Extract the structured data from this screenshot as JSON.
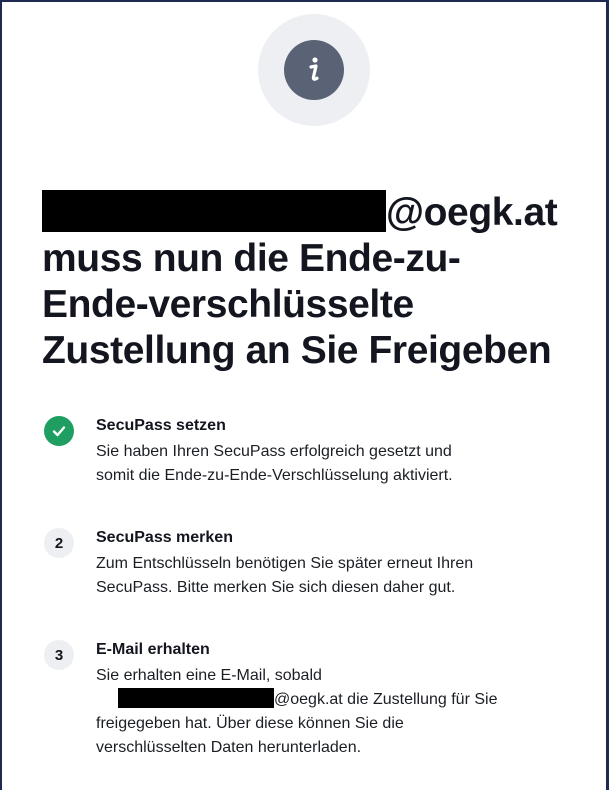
{
  "icon": {
    "name": "info-icon",
    "glyph": "i"
  },
  "heading": {
    "redacted": "[redacted]",
    "domain_suffix": "@oegk.at",
    "line2": "muss nun die Ende-zu-",
    "line3": "Ende-verschlüsselte",
    "line4": "Zustellung an Sie Freigeben"
  },
  "steps": [
    {
      "marker": "check-icon",
      "status": "done",
      "title": "SecuPass setzen",
      "text_line1": "Sie haben Ihren SecuPass erfolgreich gesetzt und",
      "text_line2": "somit die Ende-zu-Ende-Verschlüsselung aktiviert."
    },
    {
      "marker": "2",
      "title": "SecuPass merken",
      "text_line1": "Zum Entschlüsseln benötigen Sie später erneut Ihren",
      "text_line2": "SecuPass. Bitte merken Sie sich diesen daher gut."
    },
    {
      "marker": "3",
      "title": "E-Mail erhalten",
      "text_line1": "Sie erhalten eine E-Mail, sobald",
      "text_line2_suffix": "@oegk.at die Zustellung für Sie",
      "text_line3": "freigegeben hat. Über diese können Sie die",
      "text_line4": "verschlüsselten Daten herunterladen."
    }
  ],
  "colors": {
    "frame": "#1f2a52",
    "icon_bg": "#5a6275",
    "icon_halo": "#eeeff2",
    "success": "#1e9e61",
    "text": "#14161f",
    "redaction": "#000000"
  }
}
